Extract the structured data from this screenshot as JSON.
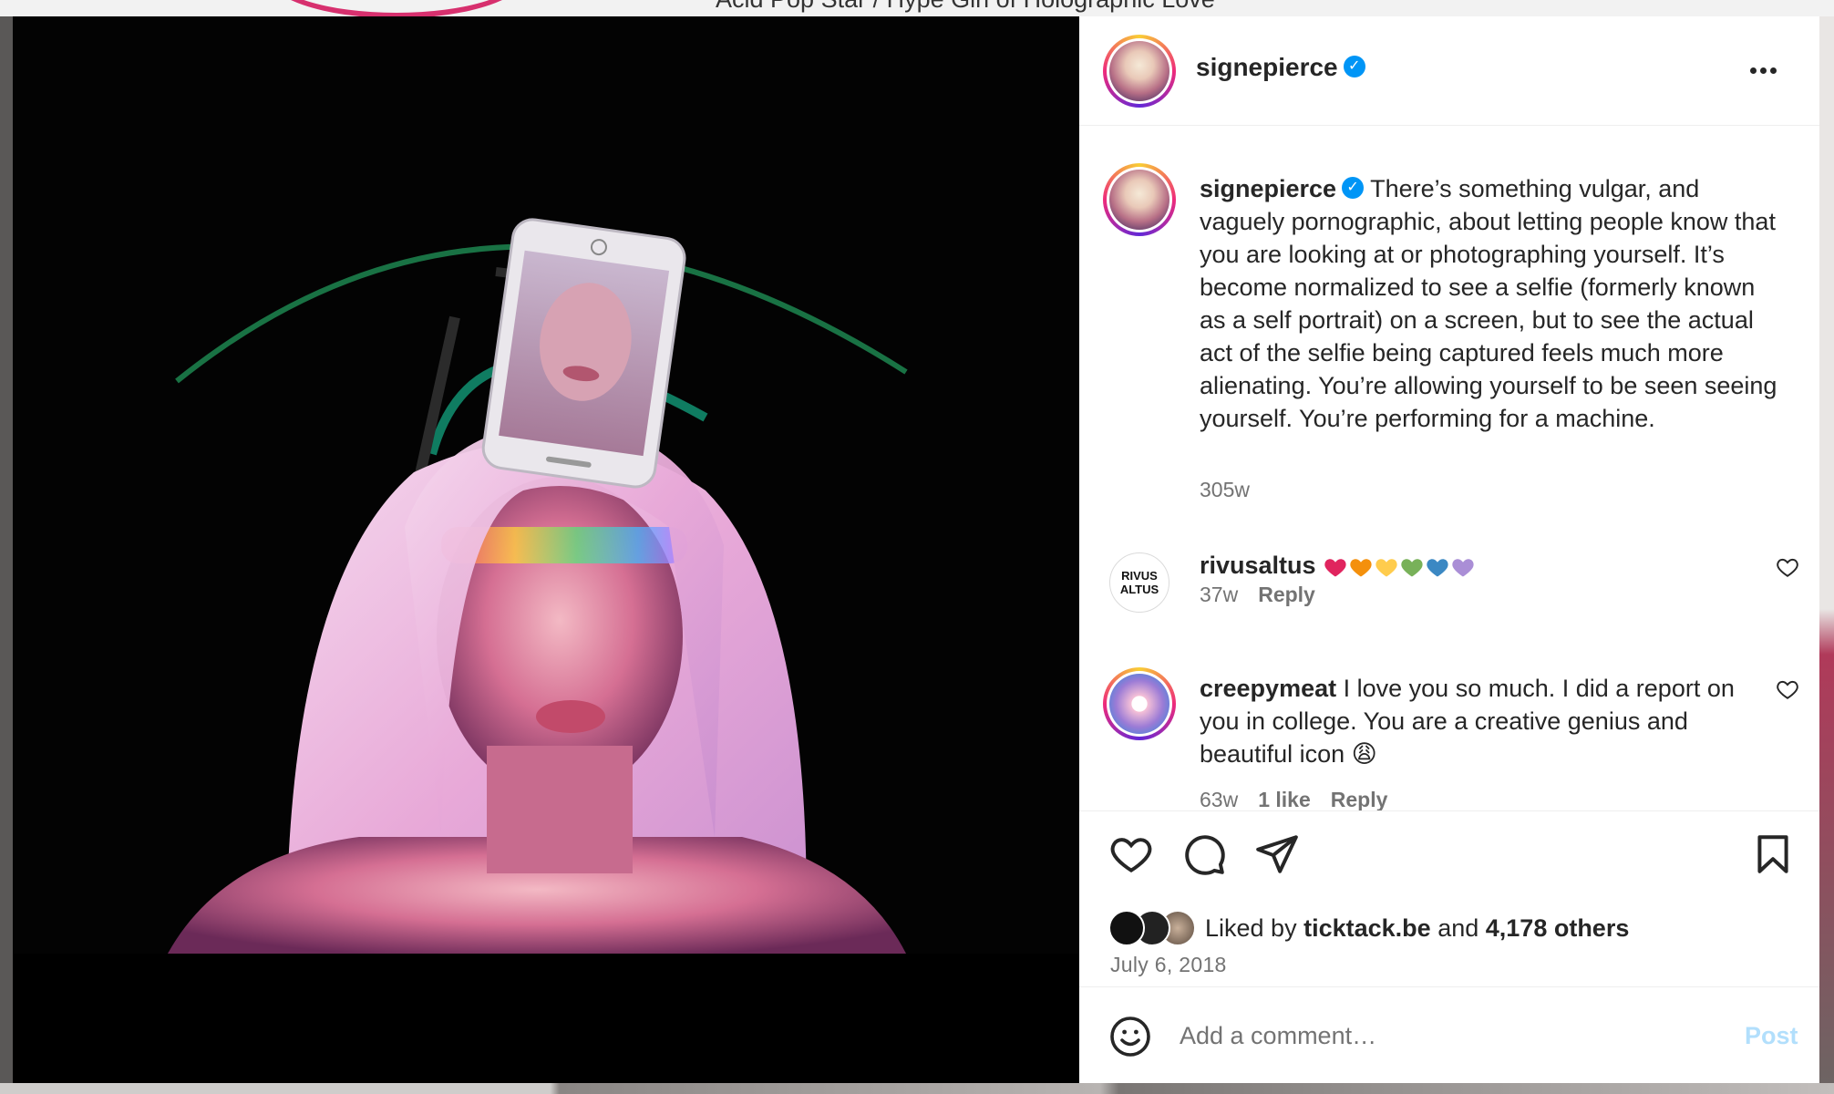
{
  "background": {
    "title_text": "Acid Pop Star / Hype Girl of Holographic Love"
  },
  "post": {
    "username": "signepierce",
    "verified": true,
    "caption": "There’s something vulgar, and vaguely pornographic, about letting people know that you are looking at or photographing yourself. It’s become normalized to see a selfie (formerly known as a self portrait) on a screen, but to see the actual act of the selfie being captured feels much more alienating.  You’re allowing yourself to be seen seeing yourself. You’re performing for a machine.",
    "caption_age": "305w",
    "liked_by_prefix": "Liked by",
    "liked_by_user": "ticktack.be",
    "liked_by_and": "and",
    "liked_by_others": "4,178 others",
    "date": "July 6, 2018"
  },
  "comments": [
    {
      "username": "rivusaltus",
      "avatar_text": "RIVUS ALTUS",
      "text": "",
      "hearts": [
        "#e0245e",
        "#f4900c",
        "#ffcc4d",
        "#78b159",
        "#3b88c3",
        "#aa8ed6"
      ],
      "age": "37w",
      "reply_label": "Reply"
    },
    {
      "username": "creepymeat",
      "text": "I love you so much. I did a report on you in college. You are a creative genius and beautiful icon 😩",
      "age": "63w",
      "likes": "1 like",
      "reply_label": "Reply"
    }
  ],
  "comment_box": {
    "placeholder": "Add a comment…",
    "post_label": "Post"
  },
  "icons": {
    "more": "more-options-icon",
    "like": "heart-icon",
    "comment": "comment-icon",
    "share": "share-icon",
    "save": "bookmark-icon",
    "emoji": "emoji-icon"
  }
}
